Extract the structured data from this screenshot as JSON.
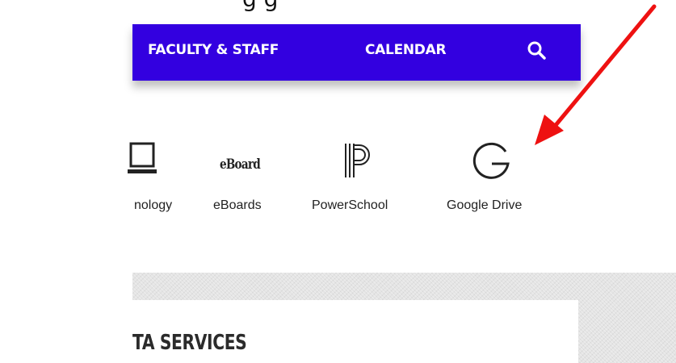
{
  "top_text": "g      g",
  "nav": {
    "faculty_label": "FACULTY & STAFF",
    "calendar_label": "CALENDAR",
    "search_icon": "search-icon",
    "background": "#3300e0"
  },
  "quick_links": [
    {
      "label": "nology",
      "icon": "laptop-icon"
    },
    {
      "label": "eBoards",
      "icon": "eboard-logo-icon",
      "icon_text": "eBoard"
    },
    {
      "label": "PowerSchool",
      "icon": "powerschool-icon"
    },
    {
      "label": "Google Drive",
      "icon": "google-g-icon"
    }
  ],
  "section": {
    "heading": "TA SERVICES"
  },
  "annotation": {
    "arrow_color": "#ee1111"
  }
}
